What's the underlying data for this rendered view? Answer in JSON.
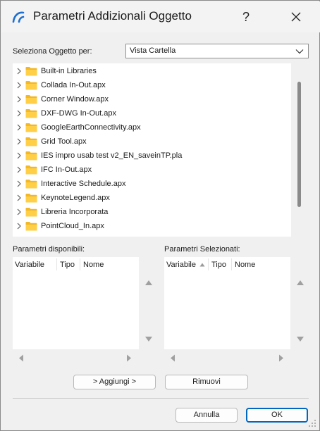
{
  "window": {
    "title": "Parametri Addizionali Oggetto",
    "help_label": "?",
    "accent_color": "#0067c0",
    "icon": "archicad-logo-icon"
  },
  "selector": {
    "label": "Seleziona Oggetto per:",
    "value": "Vista Cartella"
  },
  "tree": {
    "items": [
      {
        "label": "Built-in Libraries"
      },
      {
        "label": "Collada In-Out.apx"
      },
      {
        "label": "Corner Window.apx"
      },
      {
        "label": "DXF-DWG In-Out.apx"
      },
      {
        "label": "GoogleEarthConnectivity.apx"
      },
      {
        "label": "Grid Tool.apx"
      },
      {
        "label": "IES impro usab test v2_EN_saveinTP.pla"
      },
      {
        "label": "IFC In-Out.apx"
      },
      {
        "label": "Interactive Schedule.apx"
      },
      {
        "label": "KeynoteLegend.apx"
      },
      {
        "label": "Libreria Incorporata"
      },
      {
        "label": "PointCloud_In.apx"
      }
    ]
  },
  "available": {
    "title": "Parametri disponibili:",
    "columns": [
      "Variabile",
      "Tipo",
      "Nome"
    ]
  },
  "selected": {
    "title": "Parametri Selezionati:",
    "columns": [
      "Variabile",
      "Tipo",
      "Nome"
    ]
  },
  "actions": {
    "add_label": "> Aggiungi >",
    "remove_label": "Rimuovi"
  },
  "footer": {
    "cancel_label": "Annulla",
    "ok_label": "OK"
  }
}
